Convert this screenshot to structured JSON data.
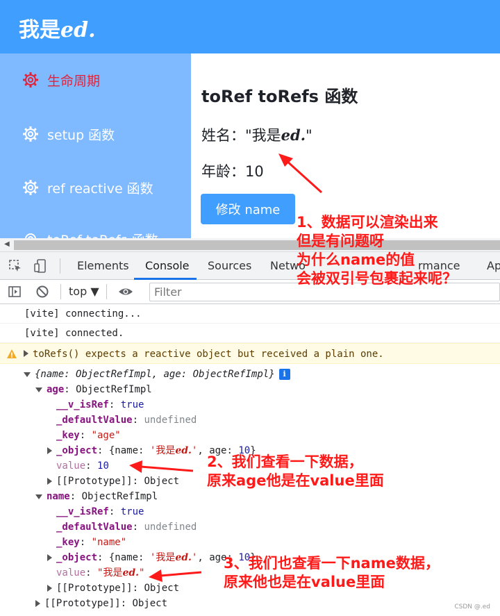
{
  "app": {
    "brand_prefix": "我是",
    "brand_ital": "ed.",
    "sidebar": [
      {
        "label": "生命周期",
        "active": true
      },
      {
        "label": "setup 函数",
        "active": false
      },
      {
        "label": "ref reactive 函数",
        "active": false
      },
      {
        "label": "toRef toRefs 函数",
        "active": false
      }
    ],
    "page_title": "toRef toRefs 函数",
    "name_label": "姓名：",
    "name_value_prefix": "\"我是",
    "name_value_ital": "ed.",
    "name_value_suffix": "\"",
    "age_label": "年龄：",
    "age_value": "10",
    "button_label": "修改 name"
  },
  "devtools": {
    "tabs": [
      "Elements",
      "Console",
      "Sources",
      "Netwo",
      "rmance",
      "Ap"
    ],
    "active_tab": "Console",
    "context": "top",
    "filter_placeholder": "Filter",
    "logs": [
      "[vite] connecting...",
      "[vite] connected."
    ],
    "warning": "toRefs() expects a reactive object but received a plain one.",
    "tree": {
      "summary_prefix": "{name: ",
      "summary_type1": "ObjectRefImpl",
      "summary_mid": ", age: ",
      "summary_type2": "ObjectRefImpl",
      "summary_suffix": "}",
      "age_key": "age",
      "age_type": "ObjectRefImpl",
      "name_key": "name",
      "name_type": "ObjectRefImpl",
      "is_ref_key": "__v_isRef",
      "is_ref_val": "true",
      "default_key": "_defaultValue",
      "default_val": "undefined",
      "key_key": "_key",
      "age_key_val": "\"age\"",
      "name_key_val": "\"name\"",
      "object_key": "_object",
      "object_prefix": "{name: ",
      "object_str_a": "'我是",
      "object_str_ed": "ed.",
      "object_str_b": "'",
      "object_mid": ", age: ",
      "object_age": "10",
      "object_suffix": "}",
      "value_key": "value",
      "age_value": "10",
      "name_value_a": "\"我是",
      "name_value_ed": "ed.",
      "name_value_b": "\"",
      "prototype": "[[Prototype]]",
      "prototype_type": "Object"
    }
  },
  "annotations": {
    "note1": "1、数据可以渲染出来\n但是有问题呀\n为什么name的值\n会被双引号包裹起来呢？",
    "note2": "2、我们查看一下数据，\n原来age他是在value里面",
    "note3": "3、我们也查看一下name数据，\n原来他也是在value里面",
    "watermark": "CSDN @.ed"
  },
  "colors": {
    "header": "#409eff",
    "sidebar": "#7fb9ff",
    "active_menu": "#e2233a",
    "annotation": "#ff1a1a"
  }
}
